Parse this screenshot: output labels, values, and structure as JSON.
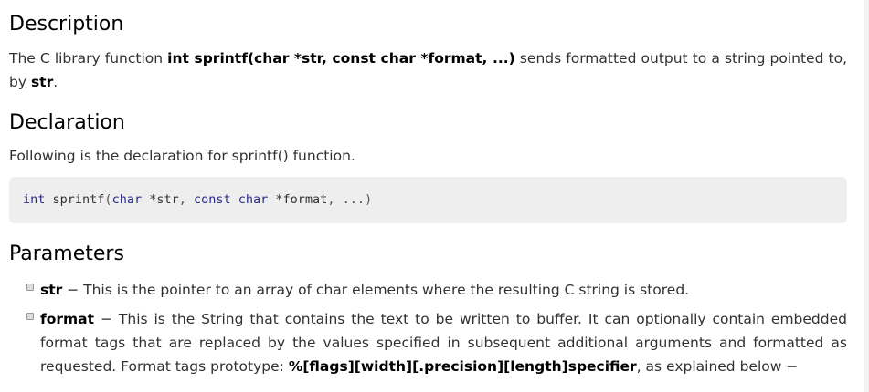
{
  "description": {
    "heading": "Description",
    "text_pre": "The C library function ",
    "text_bold": "int sprintf(char *str, const char *format, ...)",
    "text_mid": " sends formatted output to a string pointed to, by ",
    "text_bold2": "str",
    "text_post": "."
  },
  "declaration": {
    "heading": "Declaration",
    "intro": "Following is the declaration for sprintf() function.",
    "code": {
      "kw_int": "int",
      "fn": " sprintf",
      "paren_open": "(",
      "kw_char": "char",
      "arg1": " *str",
      "comma1": ",",
      "kw_const": " const",
      "kw_char2": " char",
      "arg2": " *format",
      "comma2": ",",
      "ellipsis": " ...",
      "paren_close": ")"
    }
  },
  "parameters": {
    "heading": "Parameters",
    "items": [
      {
        "name": "str",
        "text": " − This is the pointer to an array of char elements where the resulting C string is stored."
      },
      {
        "name": "format",
        "text": " − This is the String that contains the text to be written to buffer. It can optionally contain embedded format tags that are replaced by the values specified in subsequent additional arguments and formatted as requested. Format tags prototype: ",
        "prototype": "%[flags][width][.precision][length]specifier",
        "text_post": ", as explained below −"
      }
    ]
  }
}
